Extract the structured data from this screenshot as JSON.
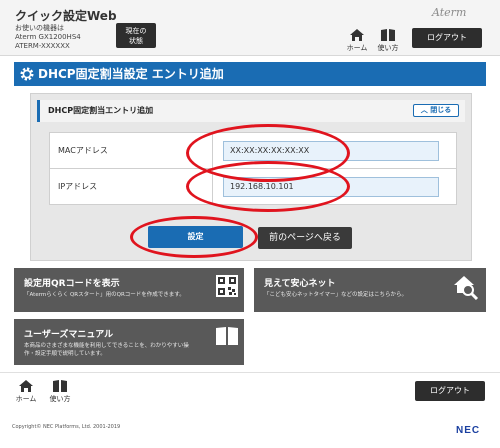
{
  "header": {
    "app_title": "クイック設定Web",
    "device_caption_1": "お使いの機器は",
    "device_caption_2": "Aterm GX1200HS4",
    "device_caption_3": "ATERM-XXXXXX",
    "status_button_1": "現在の",
    "status_button_2": "状態",
    "brand": "Aterm",
    "home_label": "ホーム",
    "help_label": "使い方",
    "logout_label": "ログアウト"
  },
  "section": {
    "title": "DHCP固定割当設定 エントリ追加"
  },
  "panel": {
    "subtitle": "DHCP固定割当エントリ追加",
    "close_label": "閉じる",
    "mac_label": "MACアドレス",
    "mac_value": "XX:XX:XX:XX:XX:XX",
    "ip_label": "IPアドレス",
    "ip_value": "192.168.10.101"
  },
  "actions": {
    "set_label": "設定",
    "back_label": "前のページへ戻る"
  },
  "tiles": {
    "qr_title": "設定用QRコードを表示",
    "qr_desc": "「Atermらくらく QRスタート」用のQRコードを作成できます。",
    "safe_title": "見えて安心ネット",
    "safe_desc": "「こども安心ネットタイマー」などの設定はこちらから。",
    "manual_title": "ユーザーズマニュアル",
    "manual_desc_1": "本商品のさまざまな機能を利用してできることを、わかりやすい操",
    "manual_desc_2": "作・設定手順で説明しています。"
  },
  "footer": {
    "home_label": "ホーム",
    "help_label": "使い方",
    "logout_label": "ログアウト",
    "copyright": "Copyright© NEC Platforms, Ltd. 2001-2019",
    "brand": "NEC"
  },
  "colors": {
    "accent": "#1a6cb3",
    "annotation": "#e0141e",
    "tile": "#595959"
  }
}
